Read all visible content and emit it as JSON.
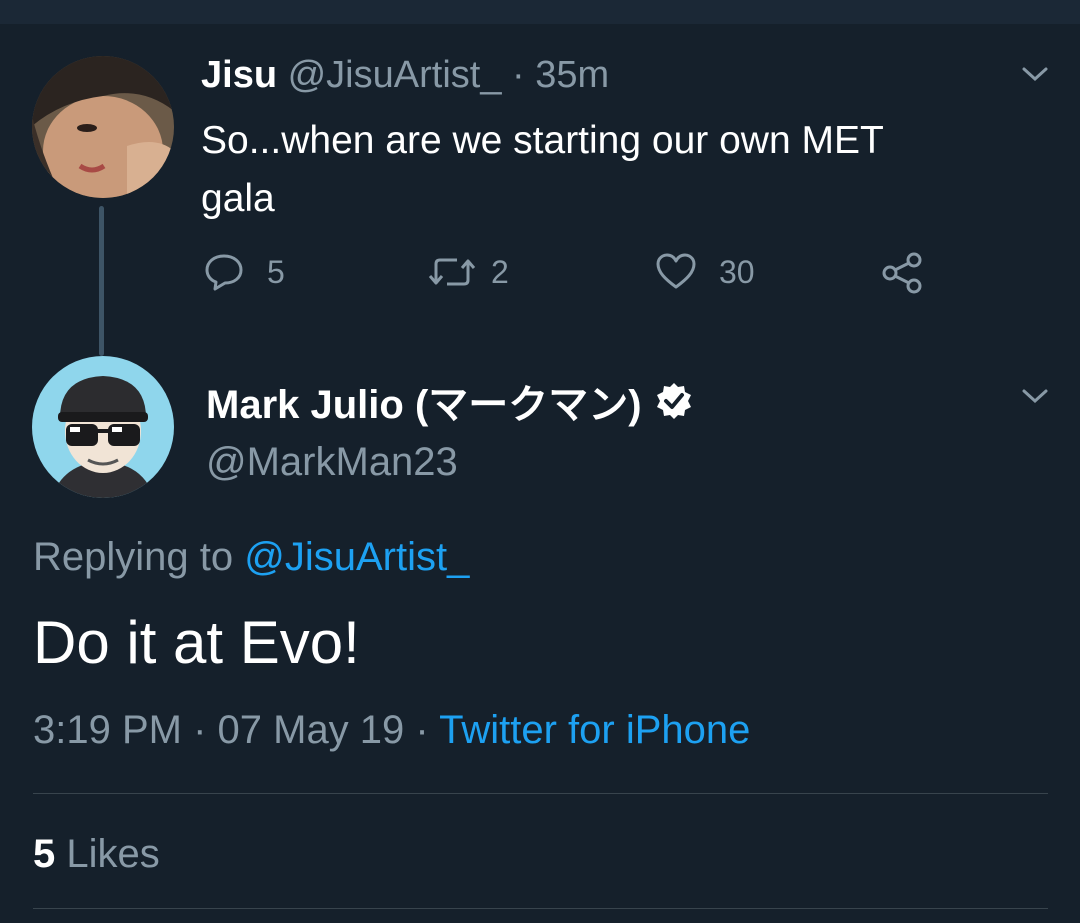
{
  "parent_tweet": {
    "name": "Jisu",
    "handle": "@JisuArtist_",
    "time": "· 35m",
    "text_line1": "So...when are we starting our own MET",
    "text_line2": "gala",
    "actions": {
      "replies": "5",
      "retweets": "2",
      "likes": "30"
    }
  },
  "reply_tweet": {
    "name": "Mark Julio (マークマン)",
    "handle": "@MarkMan23",
    "replying_prefix": "Replying to",
    "replying_handle": "@JisuArtist_",
    "text": "Do it at Evo!",
    "timestamp": "3:19 PM · 07 May 19 ·",
    "source": "Twitter for iPhone",
    "likes_count": "5",
    "likes_label": "Likes"
  },
  "colors": {
    "background": "#15202b",
    "accent": "#1da1f2",
    "muted": "#8899a6"
  },
  "icons": [
    "chevron-down-icon",
    "reply-icon",
    "retweet-icon",
    "like-icon",
    "share-icon",
    "verified-badge-icon"
  ]
}
